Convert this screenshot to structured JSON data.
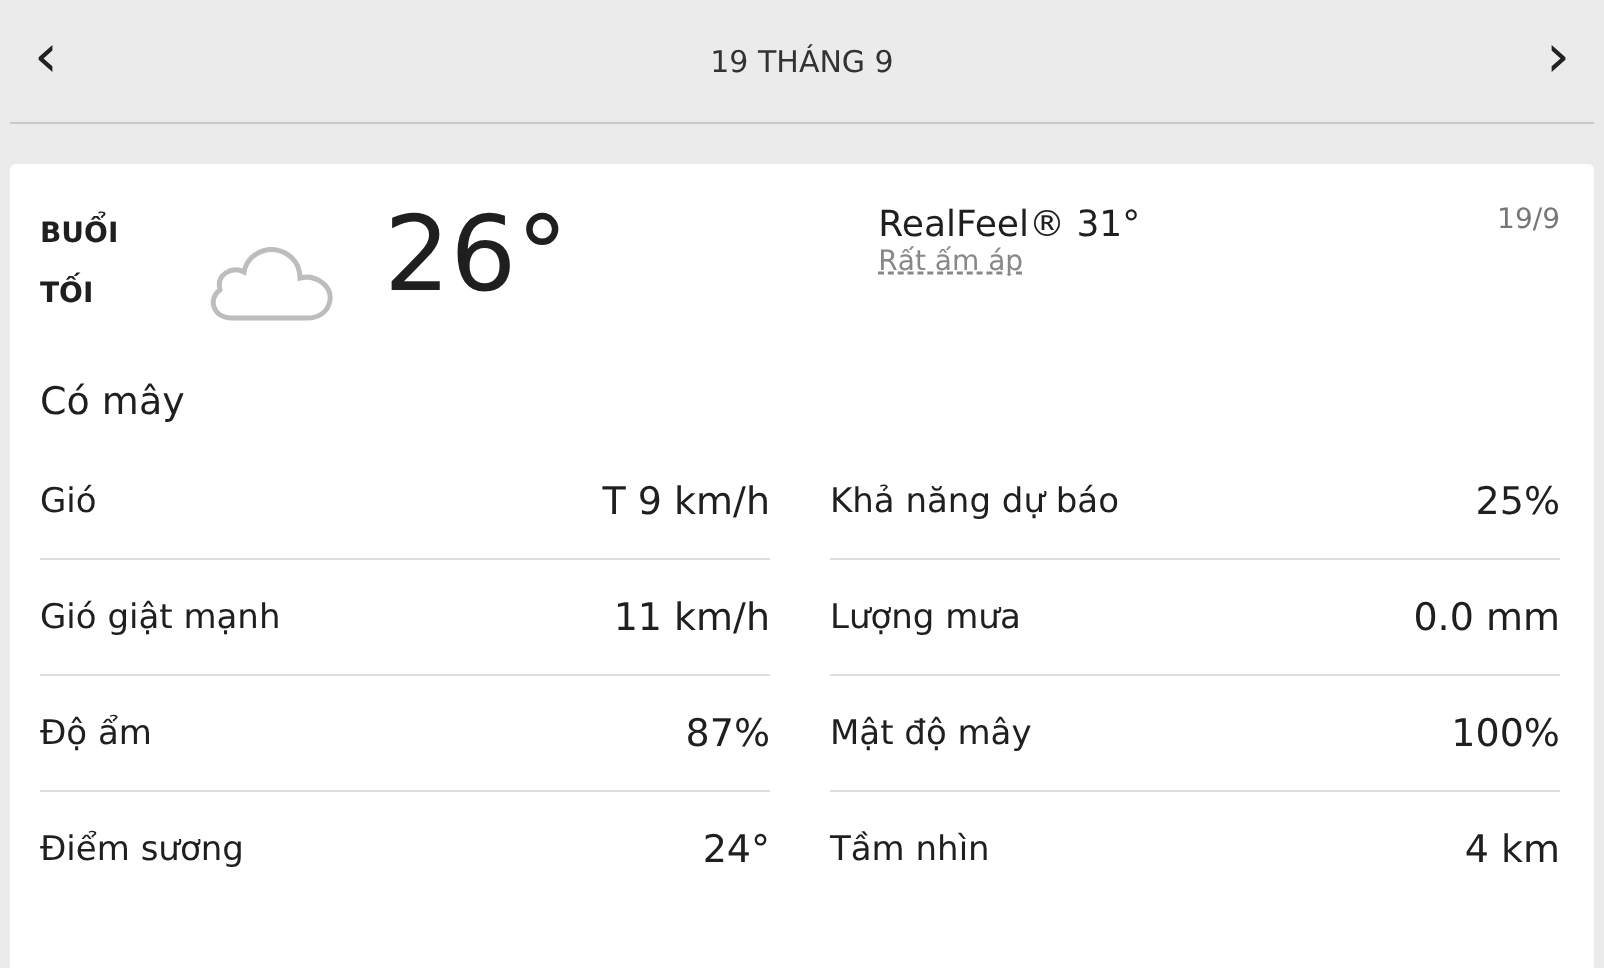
{
  "nav": {
    "prev": "‹",
    "title": "19 THÁNG 9",
    "next": "›"
  },
  "card": {
    "period": "BUỔI TỐI",
    "temperature": "26°",
    "realfeel": "RealFeel® 31°",
    "realfeel_phrase": "Rất ấm áp",
    "date": "19/9",
    "condition": "Có mây"
  },
  "details": [
    [
      {
        "label": "Gió",
        "value": "T 9 km/h"
      },
      {
        "label": "Gió giật mạnh",
        "value": "11 km/h"
      },
      {
        "label": "Độ ẩm",
        "value": "87%"
      },
      {
        "label": "Điểm sương",
        "value": "24°"
      }
    ],
    [
      {
        "label": "Khả năng dự báo",
        "value": "25%"
      },
      {
        "label": "Lượng mưa",
        "value": "0.0 mm"
      },
      {
        "label": "Mật độ mây",
        "value": "100%"
      },
      {
        "label": "Tầm nhìn",
        "value": "4 km"
      }
    ]
  ]
}
